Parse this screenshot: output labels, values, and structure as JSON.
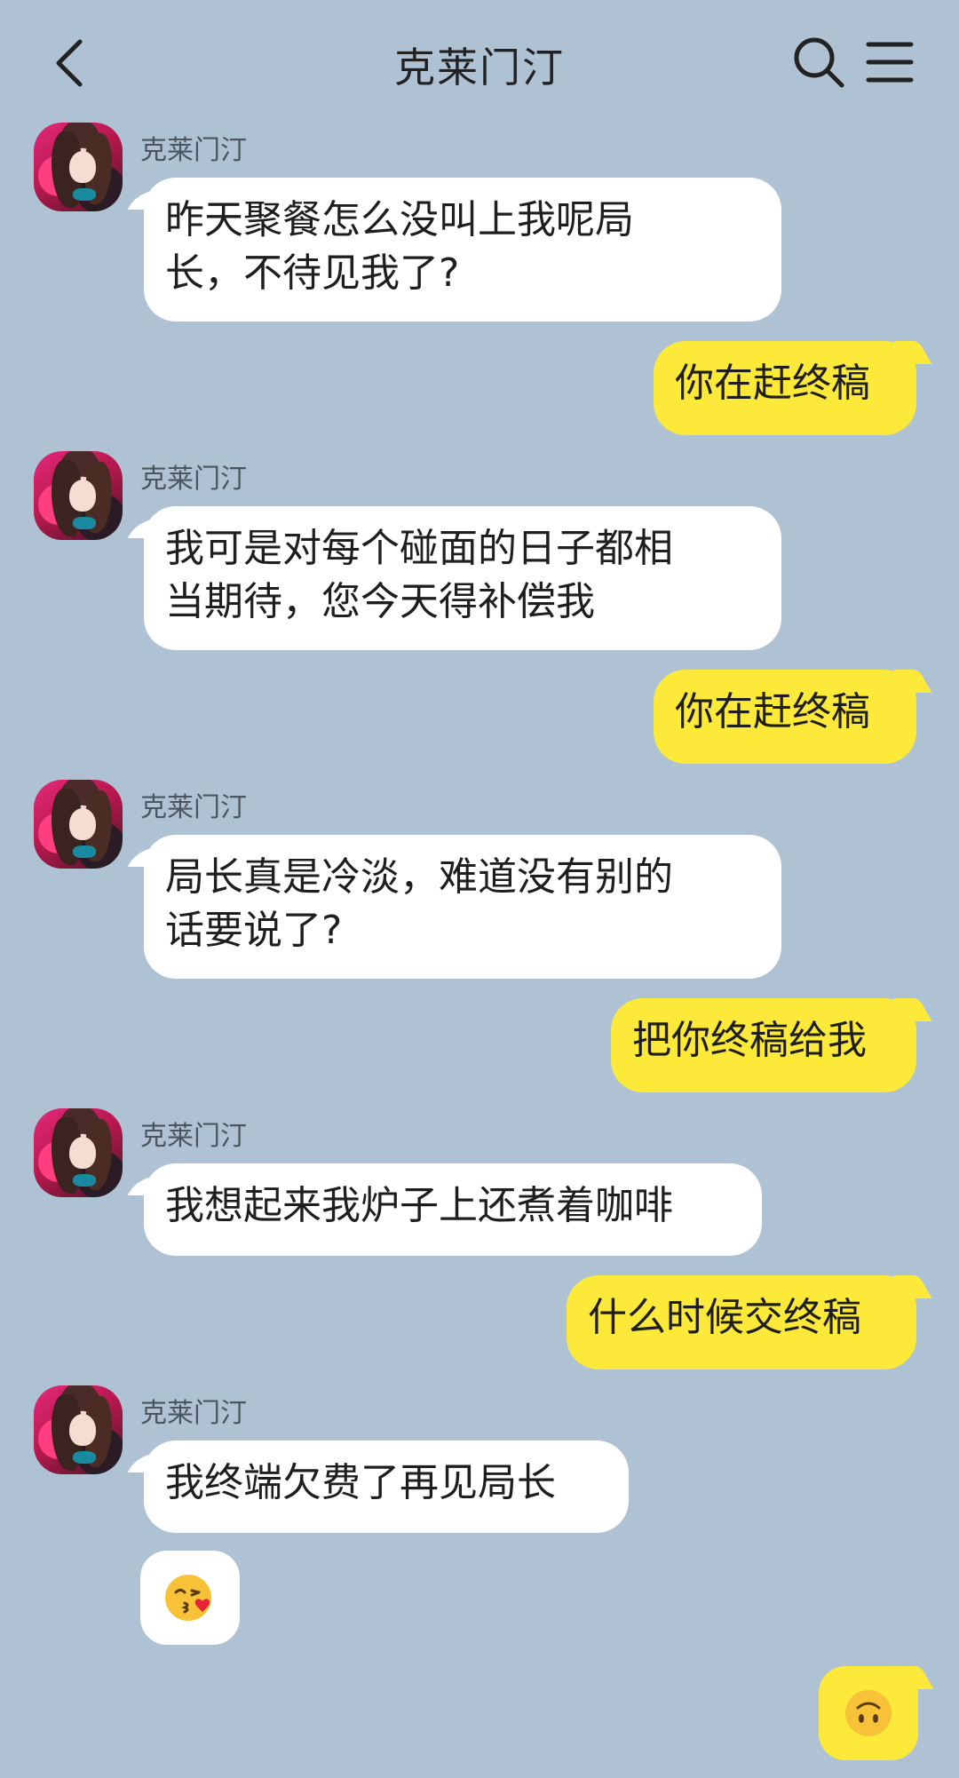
{
  "header": {
    "title": "克莱门汀"
  },
  "icons": {
    "back": "chevron-left-icon",
    "search": "search-icon",
    "menu": "hamburger-menu-icon",
    "emoji_in": "kissing-face-with-heart-emoji",
    "emoji_out": "upside-down-face-emoji"
  },
  "colors": {
    "background": "#aec2d4",
    "incoming_bubble": "#ffffff",
    "outgoing_bubble": "#fde93a"
  },
  "messages": [
    {
      "direction": "in",
      "sender": "克莱门汀",
      "lines": [
        "昨天聚餐怎么没叫上我呢局",
        "长，不待见我了?"
      ]
    },
    {
      "direction": "out",
      "lines": [
        "你在赶终稿"
      ]
    },
    {
      "direction": "in",
      "sender": "克莱门汀",
      "lines": [
        "我可是对每个碰面的日子都相",
        "当期待，您今天得补偿我"
      ]
    },
    {
      "direction": "out",
      "lines": [
        "你在赶终稿"
      ]
    },
    {
      "direction": "in",
      "sender": "克莱门汀",
      "lines": [
        "局长真是冷淡，难道没有别的",
        "话要说了?"
      ]
    },
    {
      "direction": "out",
      "lines": [
        "把你终稿给我"
      ]
    },
    {
      "direction": "in",
      "sender": "克莱门汀",
      "lines": [
        "我想起来我炉子上还煮着咖啡"
      ]
    },
    {
      "direction": "out",
      "lines": [
        "什么时候交终稿"
      ]
    },
    {
      "direction": "in",
      "sender": "克莱门汀",
      "lines": [
        "我终端欠费了再见局长"
      ]
    }
  ]
}
